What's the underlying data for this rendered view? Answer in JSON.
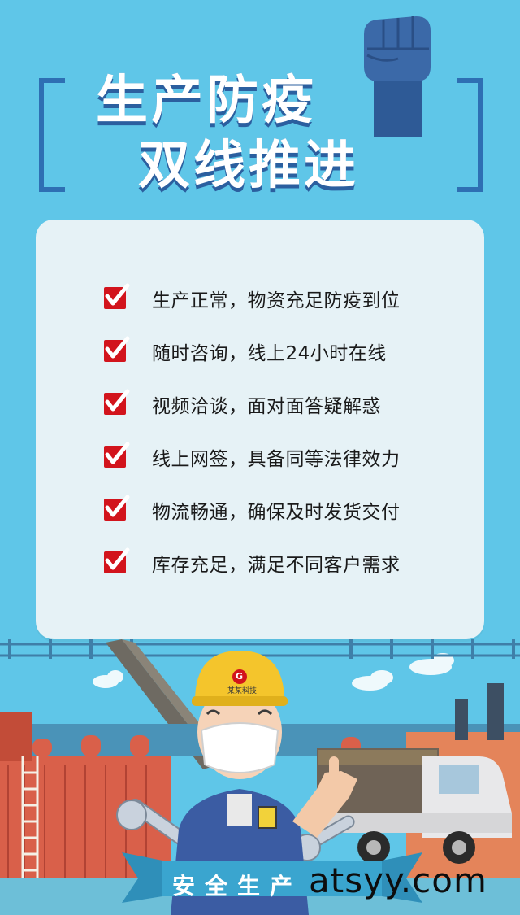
{
  "title": {
    "line1": "生产防疫",
    "line2": "双线推进"
  },
  "checklist": [
    {
      "text": "生产正常，物资充足防疫到位"
    },
    {
      "text": "随时咨询，线上24小时在线"
    },
    {
      "text": "视频洽谈，面对面答疑解惑"
    },
    {
      "text": "线上网签，具备同等法律效力"
    },
    {
      "text": "物流畅通，确保及时发货交付"
    },
    {
      "text": "库存充足，满足不同客户需求"
    }
  ],
  "illustration": {
    "helmet_logo": "G",
    "helmet_text": "某某科技",
    "ribbon": "安全生产"
  },
  "watermark": "atsyy.com",
  "colors": {
    "background": "#5fc6e8",
    "title_shadow": "#2b5f9f",
    "check": "#d2141c",
    "card": "#e6f2f6"
  },
  "icons": [
    "fist-icon",
    "checkbox-icon",
    "worker-illustration",
    "truck-illustration",
    "factory-illustration",
    "wrench-icon"
  ]
}
